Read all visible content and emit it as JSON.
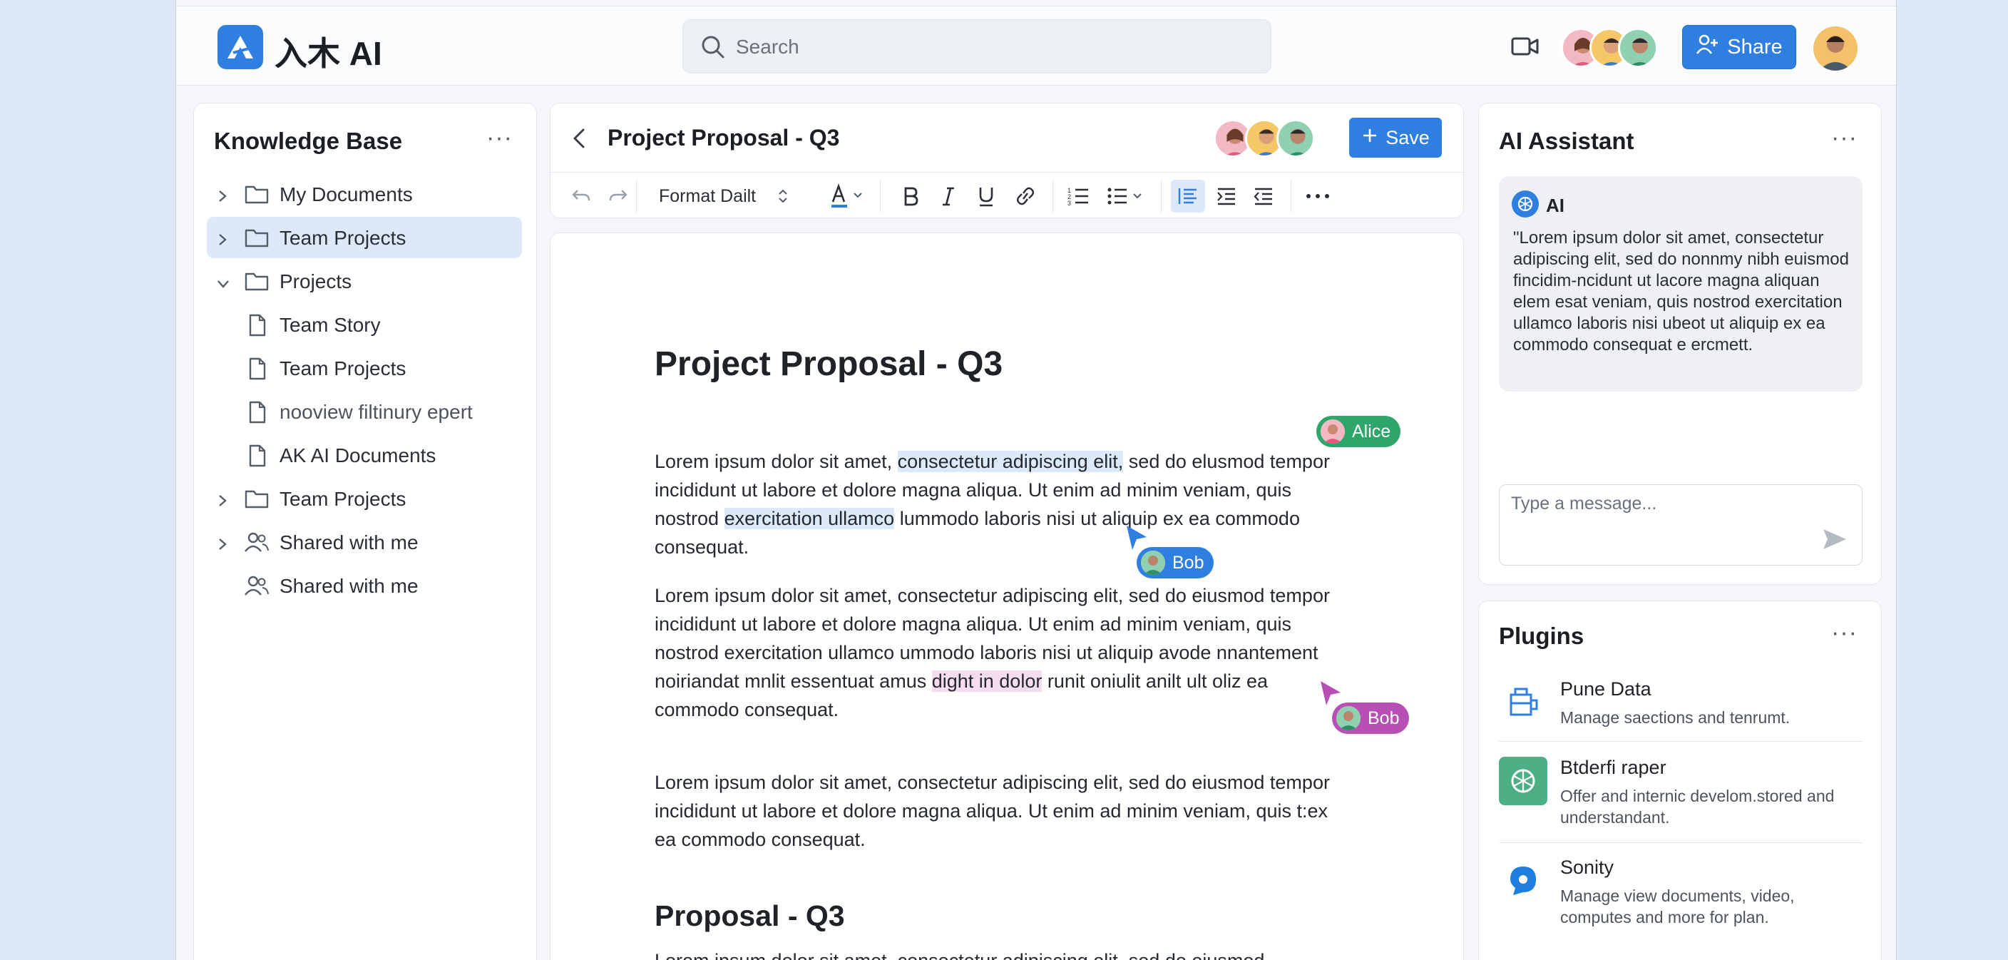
{
  "app": {
    "logo_text": "入木 AI"
  },
  "search": {
    "placeholder": "Search"
  },
  "header": {
    "share_label": "Share"
  },
  "kb": {
    "title": "Knowledge Base",
    "more": "···",
    "items": [
      {
        "label": "My Documents",
        "type": "folder",
        "chevron": "right"
      },
      {
        "label": "Team Projects",
        "type": "folder",
        "chevron": "right",
        "selected": true
      },
      {
        "label": "Projects",
        "type": "folder",
        "chevron": "down"
      },
      {
        "label": "Team Story",
        "type": "file"
      },
      {
        "label": "Team Projects",
        "type": "file"
      },
      {
        "label": "nooview filtinury epert",
        "type": "file"
      },
      {
        "label": "AK AI Documents",
        "type": "file"
      },
      {
        "label": "Team Projects",
        "type": "folder",
        "chevron": "right"
      },
      {
        "label": "Shared with me",
        "type": "people",
        "chevron": "right"
      },
      {
        "label": "Shared with me",
        "type": "people"
      }
    ]
  },
  "editor": {
    "title": "Project Proposal - Q3",
    "save_label": "Save",
    "format_select": "Format Dailt"
  },
  "doc": {
    "heading": "Project Proposal - Q3",
    "p1": {
      "a": "Lorem ipsum dolor sit amet, ",
      "hl": "consectetur adipiscing elit,",
      "b": " sed do elusmod tempor incididunt ut labore et dolore magna aliqua. Ut enim ad minim veniam, quis nostrod ",
      "hl2": "exercitation ullamco",
      "c": " lummodo laboris nisi ut aliquip ex ea commodo consequat."
    },
    "p2": {
      "a": "Lorem ipsum dolor sit amet, consectetur adipiscing elit, sed do eiusmod tempor incididunt ut labore et dolore magna aliqua. Ut enim ad minim veniam, quis nostrod exercitation ullamco ummodo laboris nisi ut aliquip avode nnantement noiriandat mnlit essentuat amus ",
      "hl": "dight in dolor",
      "b": " runit oniulit anilt ult oliz ea commodo consequat."
    },
    "p3": "Lorem ipsum dolor sit amet, consectetur adipiscing elit, sed do eiusmod tempor incididunt ut labore et dolore magna aliqua. Ut enim ad minim veniam, quis t:ex ea commodo consequat.",
    "heading2": "Proposal - Q3",
    "p4": "Lorem ipsum dolor sit amet, consectetur adipiscing elit, sed do eiusmod",
    "collaborators": [
      {
        "name": "Alice",
        "color": "#2ea56a"
      },
      {
        "name": "Bob",
        "color": "#2f7fe0"
      },
      {
        "name": "Bob",
        "color": "#b74fb5"
      }
    ]
  },
  "ai": {
    "title": "AI Assistant",
    "more": "···",
    "sender": "AI",
    "message": "\"Lorem ipsum dolor sit amet, consectetur adipiscing elit, sed do nonnmy nibh euismod fincidim-ncidunt ut lacore magna aliquan elem esat veniam, quis nostrod exercitation ullamco laboris nisi ubeot ut aliquip ex ea commodo consequat e ercmett.",
    "input_placeholder": "Type a message..."
  },
  "plugins": {
    "title": "Plugins",
    "more": "···",
    "items": [
      {
        "name": "Pune Data",
        "desc": "Manage saections and tenrumt."
      },
      {
        "name": "Btderfi raper",
        "desc": "Offer and internic develom.stored and understandant."
      },
      {
        "name": "Sonity",
        "desc": "Manage view documents, video, computes and more for plan."
      }
    ]
  },
  "colors": {
    "accent": "#2f7fe0",
    "selection": "#dde9f8",
    "alice": "#2ea56a",
    "bob_blue": "#2f7fe0",
    "bob_purple": "#b74fb5"
  }
}
